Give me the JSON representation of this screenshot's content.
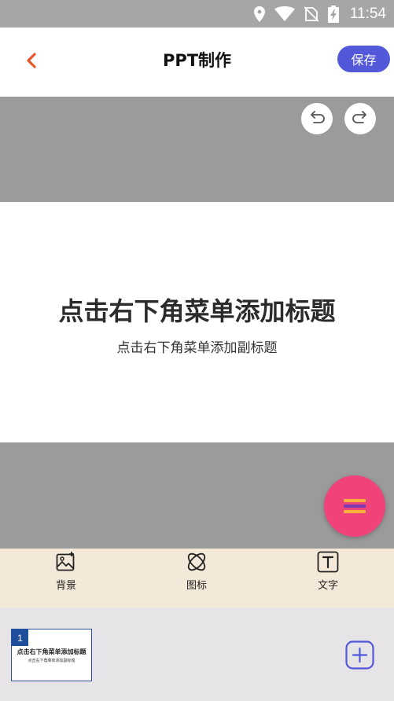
{
  "status_bar": {
    "time": "11:54",
    "icons": [
      "location-icon",
      "wifi-icon",
      "no-sim-icon",
      "battery-charging-icon"
    ]
  },
  "header": {
    "back_icon": "chevron-left-icon",
    "title": "PPT制作",
    "save_label": "保存"
  },
  "editor": {
    "undo_icon": "undo-icon",
    "redo_icon": "redo-icon",
    "slide": {
      "title": "点击右下角菜单添加标题",
      "subtitle": "点击右下角菜单添加副标题"
    },
    "fab_icon": "menu-icon"
  },
  "toolbar": {
    "items": [
      {
        "label": "背景",
        "icon": "background-image-icon"
      },
      {
        "label": "图标",
        "icon": "atom-icon"
      },
      {
        "label": "文字",
        "icon": "text-icon"
      }
    ]
  },
  "slides_strip": {
    "thumbnails": [
      {
        "number": "1",
        "title": "点击右下角菜单添加标题",
        "subtitle": "点击右下角菜单添加副标题"
      }
    ],
    "add_icon": "add-slide-icon"
  },
  "colors": {
    "accent": "#5258d8",
    "back_arrow": "#e8562a",
    "fab": "#f0437a",
    "toolbar_bg": "#f4e9d8",
    "strip_bg": "#e6e4e7",
    "editor_bg": "#9b9b9b"
  }
}
